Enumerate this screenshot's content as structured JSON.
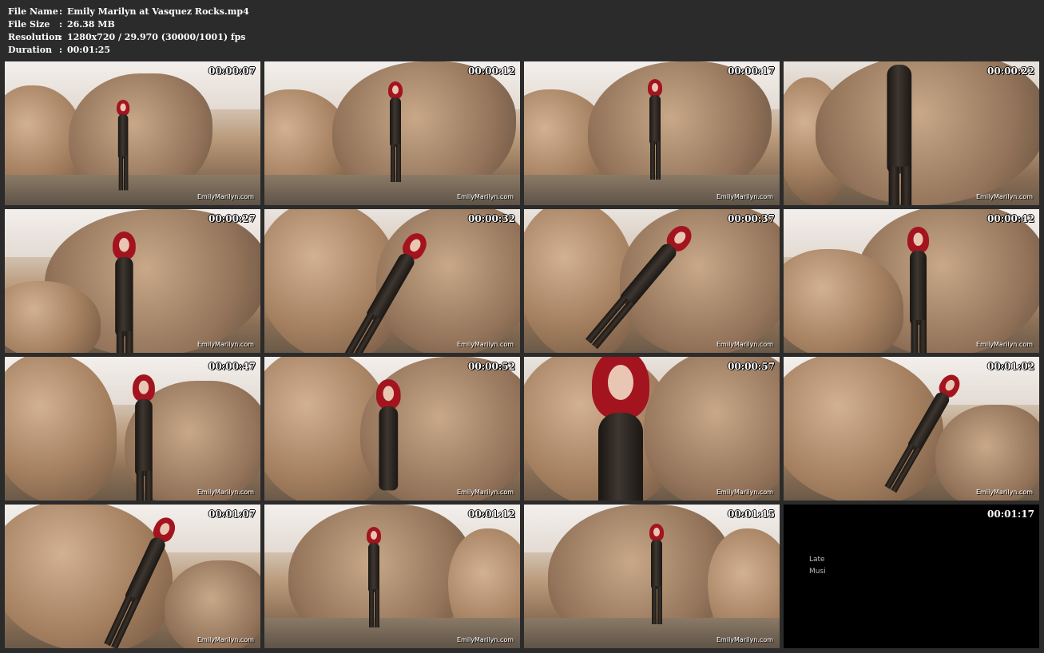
{
  "file_info": {
    "rows": [
      {
        "key": "File Name",
        "sep": ":",
        "value": "Emily Marilyn at Vasquez Rocks.mp4"
      },
      {
        "key": "File Size",
        "sep": ":",
        "value": "26.38 MB"
      },
      {
        "key": "Resolution",
        "sep": ":",
        "value": "1280x720 / 29.970 (30000/1001) fps"
      },
      {
        "key": "Duration",
        "sep": ":",
        "value": "00:01:25"
      }
    ]
  },
  "thumbnails": [
    {
      "timestamp": "00:00:07",
      "watermark": "EmilyMarilyn.com"
    },
    {
      "timestamp": "00:00:12",
      "watermark": "EmilyMarilyn.com"
    },
    {
      "timestamp": "00:00:17",
      "watermark": "EmilyMarilyn.com"
    },
    {
      "timestamp": "00:00:22",
      "watermark": "EmilyMarilyn.com"
    },
    {
      "timestamp": "00:00:27",
      "watermark": "EmilyMarilyn.com"
    },
    {
      "timestamp": "00:00:32",
      "watermark": "EmilyMarilyn.com"
    },
    {
      "timestamp": "00:00:37",
      "watermark": "EmilyMarilyn.com"
    },
    {
      "timestamp": "00:00:42",
      "watermark": "EmilyMarilyn.com"
    },
    {
      "timestamp": "00:00:47",
      "watermark": "EmilyMarilyn.com"
    },
    {
      "timestamp": "00:00:52",
      "watermark": "EmilyMarilyn.com"
    },
    {
      "timestamp": "00:00:57",
      "watermark": "EmilyMarilyn.com"
    },
    {
      "timestamp": "00:01:02",
      "watermark": "EmilyMarilyn.com"
    },
    {
      "timestamp": "00:01:07",
      "watermark": "EmilyMarilyn.com"
    },
    {
      "timestamp": "00:01:12",
      "watermark": "EmilyMarilyn.com"
    },
    {
      "timestamp": "00:01:15",
      "watermark": "EmilyMarilyn.com"
    },
    {
      "timestamp": "00:01:17",
      "watermark": "",
      "credits": [
        "Late",
        "Musi"
      ]
    }
  ]
}
